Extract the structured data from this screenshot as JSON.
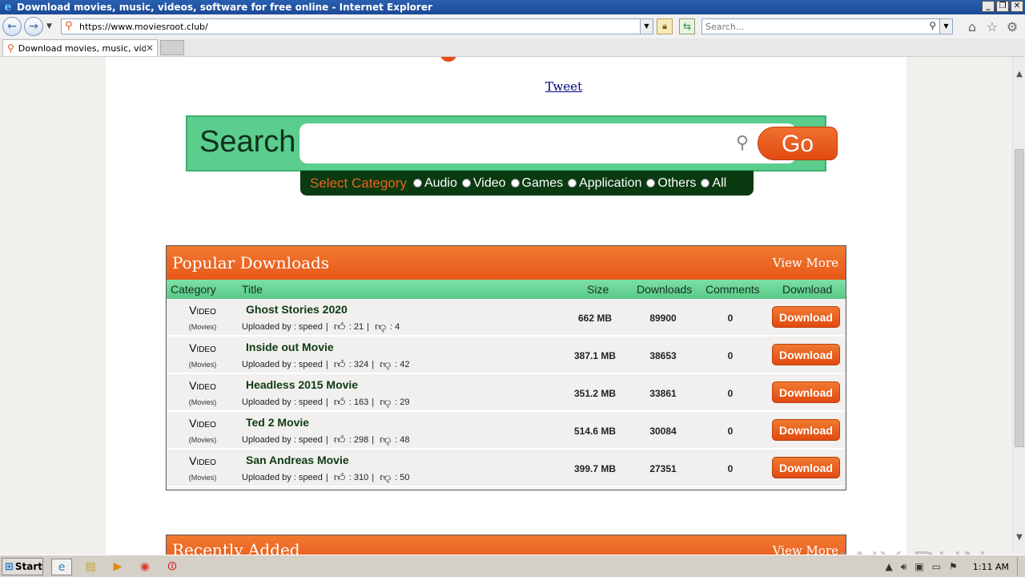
{
  "window": {
    "title": "Download movies, music, videos, software for free online - Internet Explorer",
    "controls": [
      "_",
      "❐",
      "✕"
    ]
  },
  "browser": {
    "url": "https://www.moviesroot.club/",
    "search_placeholder": "Search...",
    "tab_label": "Download movies, music, vid...",
    "tab_close": "✕"
  },
  "page": {
    "tweet": "Tweet",
    "search": {
      "label": "Search",
      "go": "Go",
      "category_label": "Select Category",
      "categories": [
        "Audio",
        "Video",
        "Games",
        "Application",
        "Others",
        "All"
      ]
    },
    "popular": {
      "title": "Popular Downloads",
      "view_more": "View More",
      "columns": [
        "Category",
        "Title",
        "Size",
        "Downloads",
        "Comments",
        "Download"
      ],
      "rows": [
        {
          "category": "Video",
          "sub": "(Movies)",
          "title": "Ghost Stories 2020",
          "uploader": "Uploaded by : speed",
          "likes": ": 21",
          "dislikes": ": 4",
          "size": "662 MB",
          "downloads": "89900",
          "comments": "0",
          "button": "Download"
        },
        {
          "category": "Video",
          "sub": "(Movies)",
          "title": "Inside out Movie",
          "uploader": "Uploaded by : speed",
          "likes": ": 324",
          "dislikes": ": 42",
          "size": "387.1 MB",
          "downloads": "38653",
          "comments": "0",
          "button": "Download"
        },
        {
          "category": "Video",
          "sub": "(Movies)",
          "title": "Headless 2015 Movie",
          "uploader": "Uploaded by : speed",
          "likes": ": 163",
          "dislikes": ": 29",
          "size": "351.2 MB",
          "downloads": "33861",
          "comments": "0",
          "button": "Download"
        },
        {
          "category": "Video",
          "sub": "(Movies)",
          "title": "Ted 2 Movie",
          "uploader": "Uploaded by : speed",
          "likes": ": 298",
          "dislikes": ": 48",
          "size": "514.6 MB",
          "downloads": "30084",
          "comments": "0",
          "button": "Download"
        },
        {
          "category": "Video",
          "sub": "(Movies)",
          "title": "San Andreas Movie",
          "uploader": "Uploaded by : speed",
          "likes": ": 310",
          "dislikes": ": 50",
          "size": "399.7 MB",
          "downloads": "27351",
          "comments": "0",
          "button": "Download"
        }
      ]
    },
    "recent": {
      "title": "Recently Added",
      "view_more": "View More"
    }
  },
  "watermark": "ANY RUN",
  "taskbar": {
    "start": "Start",
    "clock": "1:11 AM"
  },
  "colors": {
    "accent_orange": "#e8581a",
    "accent_green": "#5bcd8c",
    "category_bar": "#0a3a10"
  }
}
